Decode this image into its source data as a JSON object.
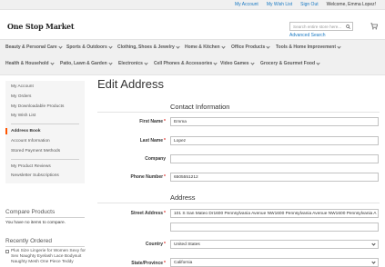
{
  "top_links": {
    "my_account": "My Account",
    "wish_list": "My Wish List",
    "sign_out": "Sign Out",
    "welcome": "Welcome, Emma Lopez!"
  },
  "header": {
    "logo": "One Stop Market",
    "search_placeholder": "Search entire store here...",
    "advanced_search": "Advanced Search"
  },
  "nav": {
    "row1": [
      "Beauty & Personal Care",
      "Sports & Outdoors",
      "Clothing, Shoes & Jewelry",
      "Home & Kitchen",
      "Office Products",
      "Tools & Home Improvement"
    ],
    "row2": [
      "Health & Household",
      "Patio, Lawn & Garden",
      "Electronics",
      "Cell Phones & Accessories",
      "Video Games",
      "Grocery & Gourmet Food"
    ]
  },
  "sidebar": {
    "items": [
      "My Account",
      "My Orders",
      "My Downloadable Products",
      "My Wish List",
      "Address Book",
      "Account Information",
      "Stored Payment Methods",
      "My Product Reviews",
      "Newsletter Subscriptions"
    ]
  },
  "compare": {
    "title": "Compare Products",
    "empty": "You have no items to compare."
  },
  "recently_ordered": {
    "title": "Recently Ordered",
    "item": "Plus Size Lingerie for Women Sexy for Sex Naughty Eyelash Lace Bodysuit Naughty Mesh One Piece Teddy"
  },
  "page": {
    "title": "Edit Address"
  },
  "contact": {
    "legend": "Contact Information",
    "first_name": {
      "label": "First Name",
      "value": "Emma"
    },
    "last_name": {
      "label": "Last Name",
      "value": "Lopez"
    },
    "company": {
      "label": "Company",
      "value": ""
    },
    "phone": {
      "label": "Phone Number",
      "value": "6505551212"
    }
  },
  "address": {
    "legend": "Address",
    "street": {
      "label": "Street Address",
      "value": "101 S San Mateo Dr1600 Pennsylvania Avenue NW1600 Pennsylvania Avenue NW1600 Pennsylvania A"
    },
    "country": {
      "label": "Country",
      "value": "United States"
    },
    "state": {
      "label": "State/Province",
      "value": "California"
    }
  },
  "required_mark": "*"
}
